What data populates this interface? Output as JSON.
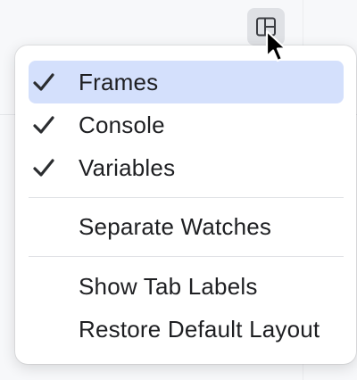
{
  "toolbar": {
    "layout_button_icon": "layout-icon"
  },
  "menu": {
    "items": [
      {
        "label": "Frames",
        "checked": true,
        "selected": true
      },
      {
        "label": "Console",
        "checked": true,
        "selected": false
      },
      {
        "label": "Variables",
        "checked": true,
        "selected": false
      },
      {
        "label": "Separate Watches",
        "checked": false,
        "selected": false
      },
      {
        "label": "Show Tab Labels",
        "checked": false,
        "selected": false
      },
      {
        "label": "Restore Default Layout",
        "checked": false,
        "selected": false
      }
    ]
  },
  "colors": {
    "selection": "#d4e0fc",
    "text": "#1e1f22",
    "separator": "#dfe1e5"
  }
}
